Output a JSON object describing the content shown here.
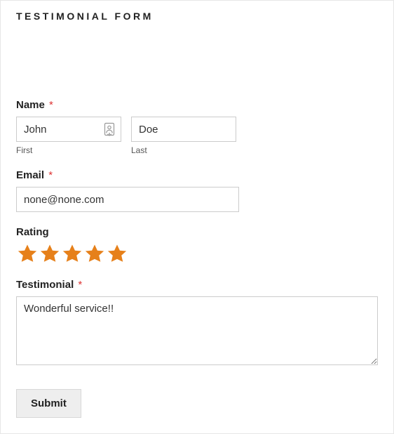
{
  "title": "TESTIMONIAL FORM",
  "name": {
    "label": "Name",
    "required_mark": "*",
    "first_value": "John",
    "first_sublabel": "First",
    "last_value": "Doe",
    "last_sublabel": "Last"
  },
  "email": {
    "label": "Email",
    "required_mark": "*",
    "value": "none@none.com"
  },
  "rating": {
    "label": "Rating",
    "value": 5,
    "max": 5,
    "star_color": "#e6801a"
  },
  "testimonial": {
    "label": "Testimonial",
    "required_mark": "*",
    "value": "Wonderful service!!"
  },
  "submit": {
    "label": "Submit"
  },
  "icons": {
    "autofill": "autofill-contact-icon"
  }
}
